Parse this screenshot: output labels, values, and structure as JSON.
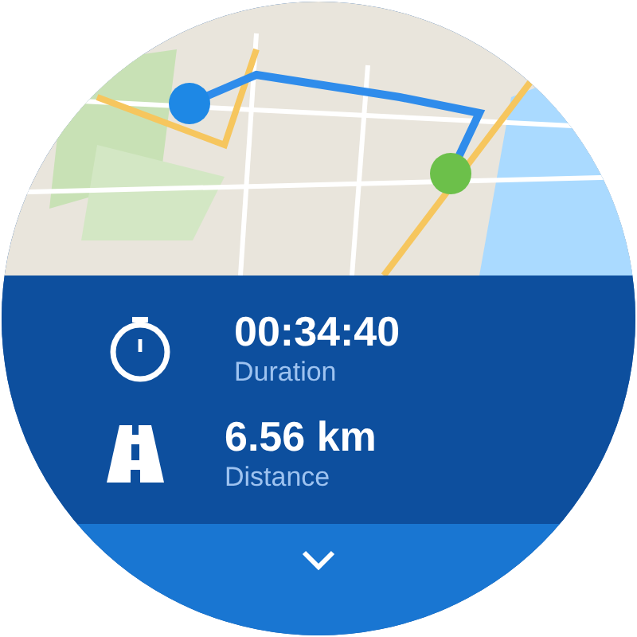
{
  "stats": [
    {
      "kind": "timer",
      "value": "00:34:40",
      "label": "Duration"
    },
    {
      "kind": "road",
      "value": "6.56 km",
      "label": "Distance"
    }
  ]
}
